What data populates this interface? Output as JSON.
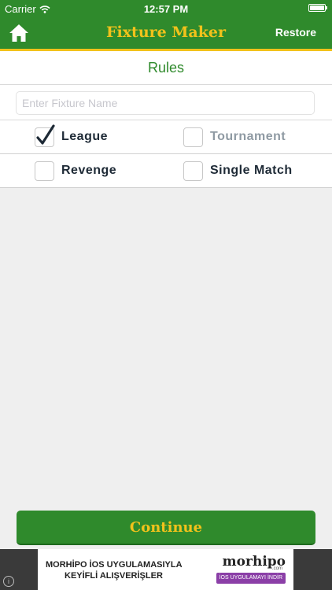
{
  "status_bar": {
    "carrier": "Carrier",
    "time": "12:57 PM"
  },
  "nav": {
    "title": "Fixture Maker",
    "restore_label": "Restore",
    "home_icon": "home-icon"
  },
  "header": {
    "title": "Rules"
  },
  "form": {
    "fixture_name_value": "",
    "fixture_name_placeholder": "Enter Fixture Name"
  },
  "options": {
    "league": {
      "label": "League",
      "checked": true
    },
    "tournament": {
      "label": "Tournament",
      "checked": false
    },
    "revenge": {
      "label": "Revenge",
      "checked": false
    },
    "single_match": {
      "label": "Single Match",
      "checked": false
    }
  },
  "continue_label": "Continue",
  "ad": {
    "line1": "MORHİPO İOS UYGULAMASIYLA",
    "line2": "KEYİFLİ ALIŞVERİŞLER",
    "brand": "morhipo",
    "brand_sub": ".com",
    "cta": "İOS UYGULAMAYI İNDİR",
    "info": "i"
  },
  "colors": {
    "primary": "#2f8a2c",
    "accent": "#f2c21b",
    "text": "#1e2a36"
  }
}
